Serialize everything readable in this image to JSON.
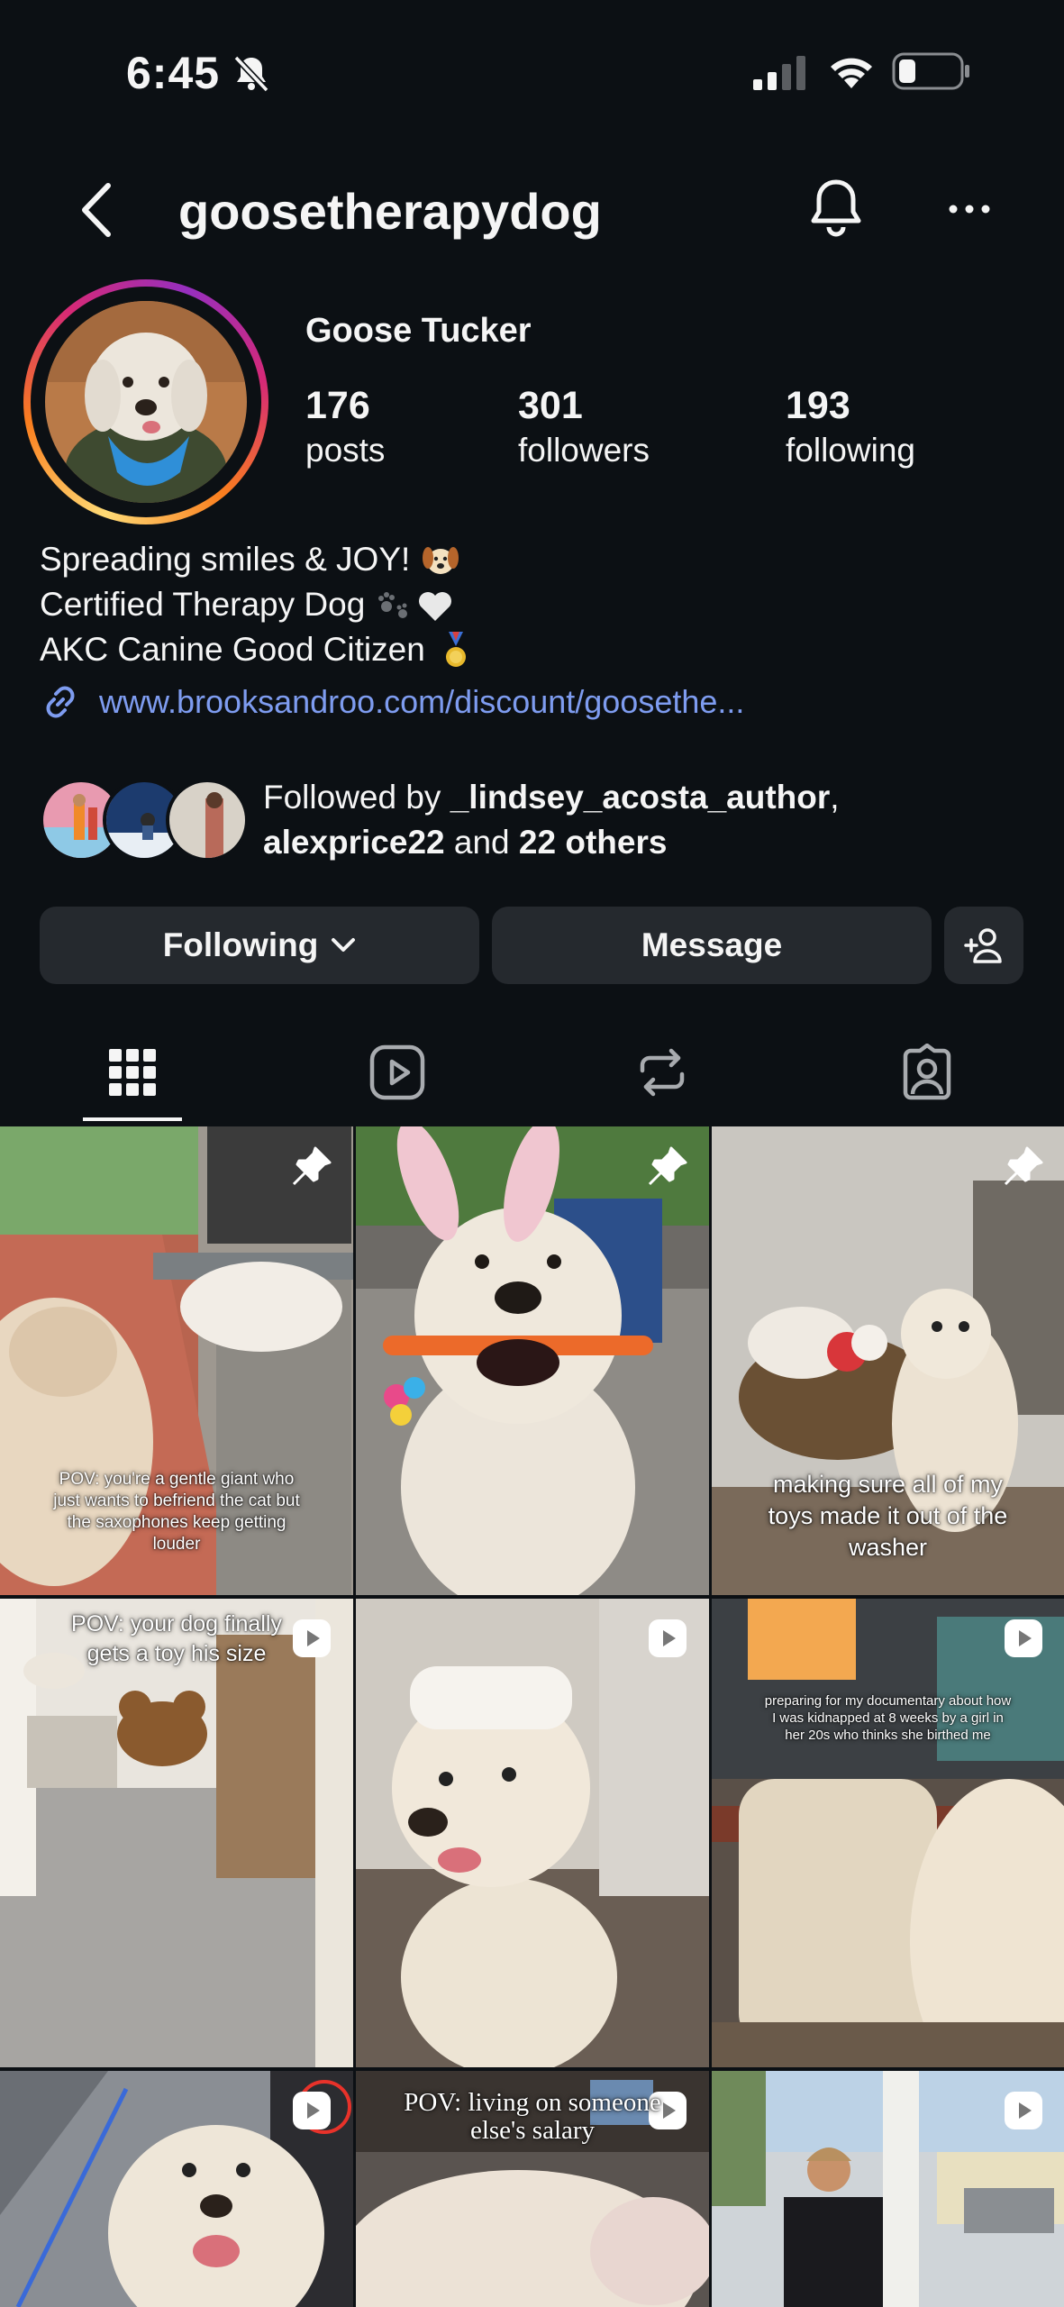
{
  "status_bar": {
    "time": "6:45",
    "icons": [
      "bell-slash-icon",
      "signal-icon",
      "wifi-icon",
      "battery-icon"
    ]
  },
  "header": {
    "username": "goosetherapydog",
    "icons": [
      "chevron-left-icon",
      "bell-icon",
      "more-icon"
    ]
  },
  "profile": {
    "name": "Goose Tucker",
    "stats": [
      {
        "value": "176",
        "label": "posts"
      },
      {
        "value": "301",
        "label": "followers"
      },
      {
        "value": "193",
        "label": "following"
      }
    ],
    "bio": [
      {
        "text": "Spreading smiles & JOY!",
        "emoji": "dog-face-emoji"
      },
      {
        "text": "Certified Therapy Dog",
        "emoji": "paws-heart-emoji"
      },
      {
        "text": "AKC Canine Good Citizen",
        "emoji": "medal-emoji"
      }
    ],
    "link": "www.brooksandroo.com/discount/goosethe...",
    "followed_by": {
      "prefix": "Followed by ",
      "user1": "_lindsey_acosta_author",
      "sep": ",",
      "user2": "alexprice22",
      "mid": " and ",
      "others": "22 others"
    }
  },
  "actions": {
    "following": "Following",
    "message": "Message",
    "add_icon": "add-person-icon"
  },
  "tabs": [
    "grid-tab",
    "reels-tab",
    "reposts-tab",
    "tagged-tab"
  ],
  "posts": [
    {
      "caption": "POV: you're a gentle giant who just wants to befriend the cat but the saxophones keep getting louder",
      "badge": "pin-icon"
    },
    {
      "caption": "",
      "badge": "pin-icon"
    },
    {
      "caption": "making sure all of my toys made it out of the washer",
      "badge": "pin-icon"
    },
    {
      "caption": "POV: your dog finally gets a toy his size",
      "badge": "reel-icon"
    },
    {
      "caption": "",
      "badge": "reel-icon"
    },
    {
      "caption": "preparing for my documentary about how I was kidnapped at 8 weeks by a girl in her 20s who thinks she birthed me",
      "badge": "reel-icon"
    },
    {
      "caption": "",
      "badge": "reel-icon"
    },
    {
      "caption": "POV: living on someone else's salary",
      "badge": "reel-icon"
    },
    {
      "caption": "",
      "badge": "reel-icon"
    }
  ],
  "colors": {
    "background": "#0c1014",
    "button": "#25292e",
    "link": "#7e9cf0"
  }
}
